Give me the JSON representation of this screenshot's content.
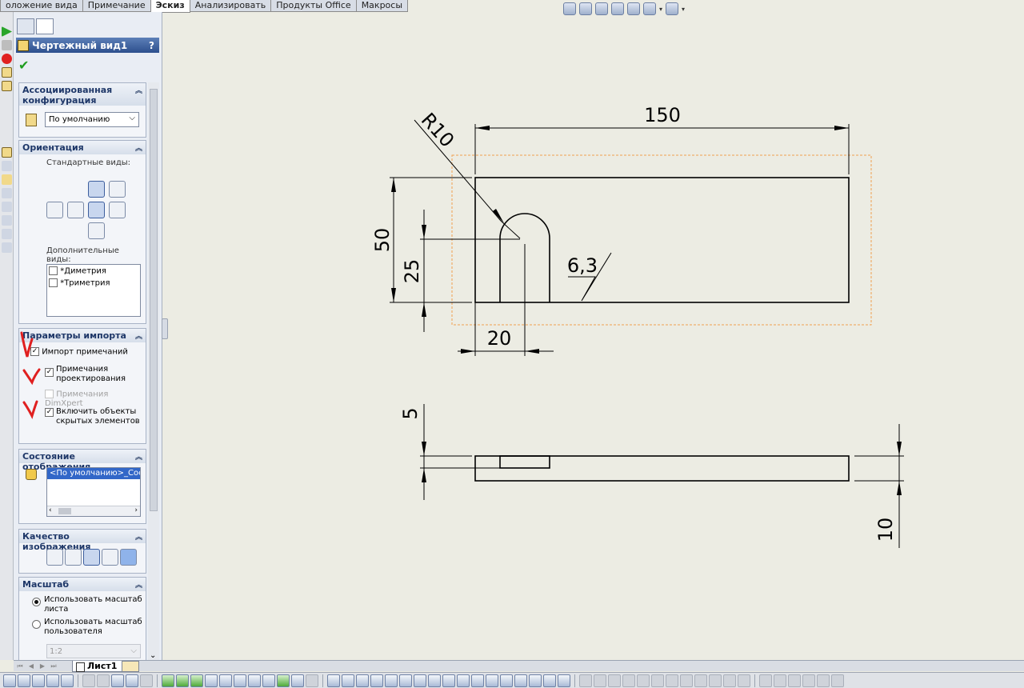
{
  "tabs": [
    {
      "label": "оложение вида",
      "active": false
    },
    {
      "label": "Примечание",
      "active": false
    },
    {
      "label": "Эскиз",
      "active": true
    },
    {
      "label": "Анализировать",
      "active": false
    },
    {
      "label": "Продукты Office",
      "active": false
    },
    {
      "label": "Макросы",
      "active": false
    }
  ],
  "view_toolbar_icons": [
    "zoom-to-fit-icon",
    "zoom-area-icon",
    "previous-view-icon",
    "rebuild-icon",
    "display-style-icon",
    "view-orientation-icon",
    "hide-show-items-icon"
  ],
  "property_manager": {
    "title": "Чертежный вид1",
    "help": "?",
    "ok_symbol": "✔",
    "reference_config": {
      "title": "Ассоциированная конфигурация",
      "selected": "По умолчанию"
    },
    "orientation": {
      "title": "Ориентация",
      "standard_views_label": "Стандартные виды:",
      "more_views_label": "Дополнительные виды:",
      "more_views": [
        {
          "label": "*Диметрия",
          "checked": false
        },
        {
          "label": "*Триметрия",
          "checked": false
        }
      ]
    },
    "import_options": {
      "title": "Параметры импорта",
      "items": [
        {
          "label": "Импорт примечаний",
          "checked": true,
          "enabled": true
        },
        {
          "label": "Примечания проектирования",
          "checked": true,
          "enabled": true
        },
        {
          "label": "Примечания DimXpert",
          "checked": false,
          "enabled": false
        },
        {
          "label": "Включить объекты скрытых элементов",
          "checked": true,
          "enabled": true
        }
      ]
    },
    "display_state": {
      "title": "Состояние отображения",
      "item": "<По умолчанию>_Сост"
    },
    "display_style": {
      "title": "Качество изображения"
    },
    "scale": {
      "title": "Масштаб",
      "options": [
        {
          "label": "Использовать масштаб листа",
          "selected": true
        },
        {
          "label": "Использовать масштаб пользователя",
          "selected": false
        }
      ],
      "custom_value": "1:2"
    }
  },
  "sheet_tab": "Лист1",
  "drawing": {
    "dimensions": {
      "width": "150",
      "height": "50",
      "slot_height": "25",
      "slot_offset": "20",
      "radius": "R10",
      "surface_finish": "6,3",
      "side_thickness": "5",
      "side_total": "10"
    },
    "colors": {
      "line": "#000000",
      "view_boundary": "#f0a050",
      "annotation_marks": "#e02020",
      "panel_header": "#3a5f9f",
      "ok_check": "#1f9d1f"
    }
  }
}
